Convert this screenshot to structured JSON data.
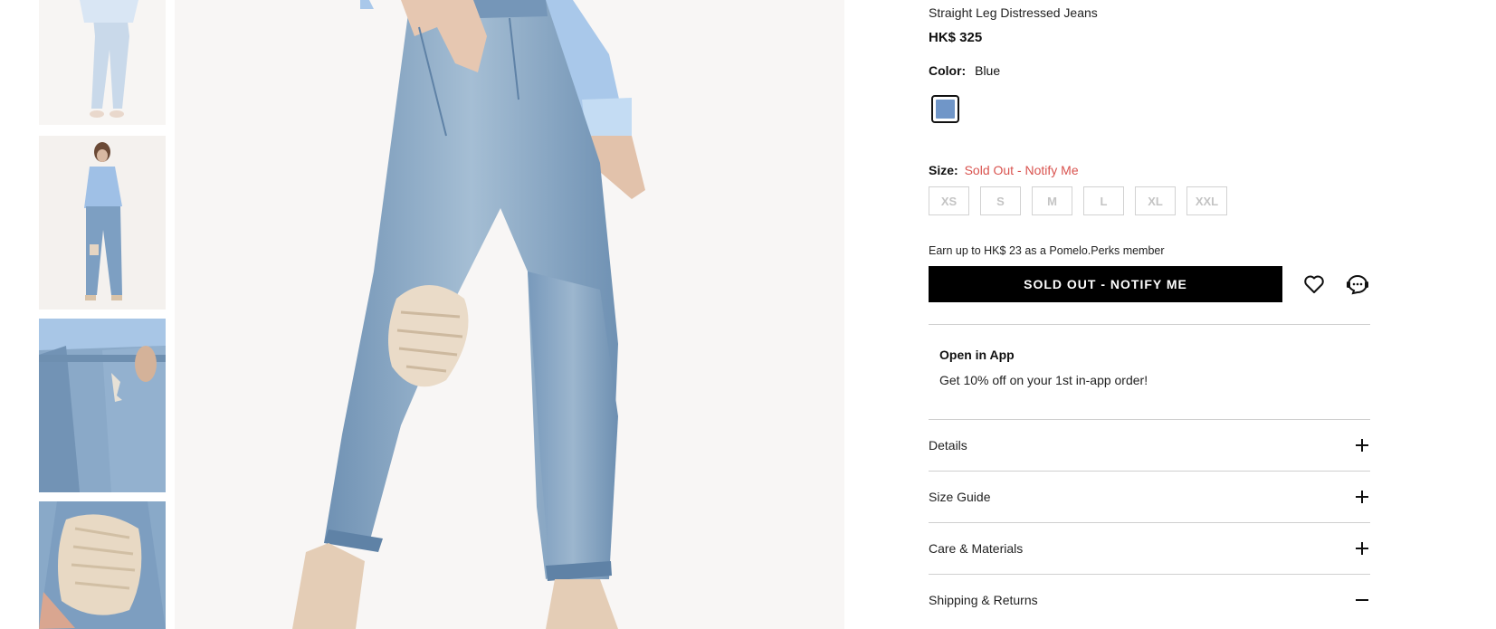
{
  "product": {
    "name": "Straight Leg Distressed Jeans",
    "price": "HK$ 325",
    "color_label": "Color:",
    "color_value": "Blue",
    "swatch_color": "#7096c8",
    "size_label": "Size:",
    "size_status": "Sold Out - Notify Me",
    "sizes": [
      "XS",
      "S",
      "M",
      "L",
      "XL",
      "XXL"
    ]
  },
  "perks_text": "Earn up to HK$ 23 as a Pomelo.Perks member",
  "cta_label": "SOLD OUT - NOTIFY ME",
  "app_promo": {
    "title": "Open in App",
    "subtitle": "Get 10% off on your 1st in-app order!"
  },
  "accordion": [
    {
      "label": "Details",
      "icon": "plus-icon"
    },
    {
      "label": "Size Guide",
      "icon": "plus-icon"
    },
    {
      "label": "Care & Materials",
      "icon": "plus-icon"
    },
    {
      "label": "Shipping & Returns",
      "icon": "minus-icon"
    }
  ],
  "icons": {
    "wishlist": "heart-icon",
    "chat": "chat-support-icon"
  },
  "colors": {
    "denim": "#8fb0cf",
    "shirt": "#a9c8ea",
    "sold_out_red": "#d9534f",
    "cta_bg": "#000000"
  }
}
